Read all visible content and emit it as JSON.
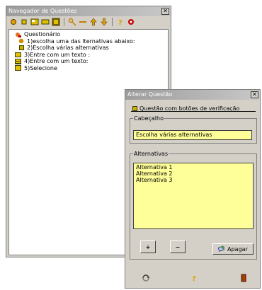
{
  "navigator": {
    "title": "Navegador de Questões",
    "close": "✕",
    "toolbar": [
      "plus-icon",
      "remove-icon",
      "move-icon",
      "box-icon",
      "dark-box-icon",
      "key-icon",
      "dash-icon",
      "up-icon",
      "down-icon",
      "help-icon",
      "settings-icon"
    ],
    "tree": {
      "root": "Questionário",
      "items": [
        {
          "label": "1)escolha uma das lternativas abaixo:",
          "icon": "radio-icon"
        },
        {
          "label": "2)Escolha várias alternativas",
          "icon": "checkbox-icon"
        },
        {
          "label": "3)Entre com um texto :",
          "icon": "textfield-icon"
        },
        {
          "label": "4)Entre com um texto:",
          "icon": "textarea-icon"
        },
        {
          "label": "5)Selecione",
          "icon": "select-icon"
        }
      ]
    }
  },
  "editor": {
    "title": "Alterar Questão",
    "close": "✕",
    "checkbox_label": "Questão com botões de verificação",
    "header_legend": "Cabeçalho",
    "header_value": "Escolha várias alternativas",
    "alternatives_legend": "Alternativas",
    "alternatives": [
      "Alternativa 1",
      "Alternativa 2",
      "Alternativa 3"
    ],
    "add_label": "+",
    "remove_label": "−",
    "delete_label": "Apagar",
    "bottom_icons": [
      "refresh-icon",
      "help-icon",
      "exit-icon"
    ]
  }
}
